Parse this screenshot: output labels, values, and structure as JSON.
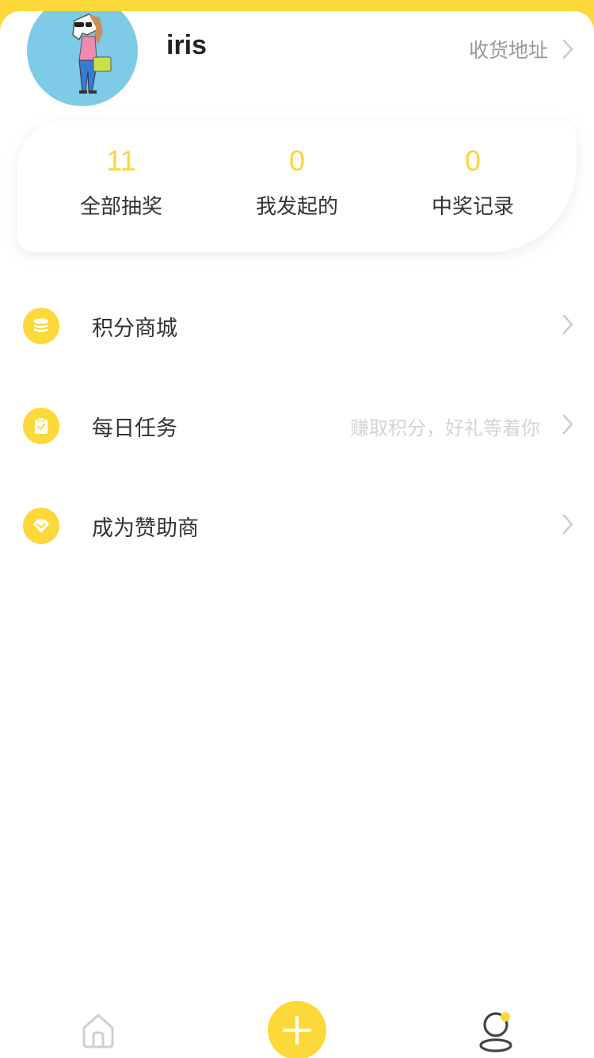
{
  "profile": {
    "username": "iris",
    "address_link": "收货地址"
  },
  "stats": [
    {
      "value": "11",
      "label": "全部抽奖"
    },
    {
      "value": "0",
      "label": "我发起的"
    },
    {
      "value": "0",
      "label": "中奖记录"
    }
  ],
  "menu": [
    {
      "label": "积分商城",
      "hint": "",
      "icon": "coins-icon"
    },
    {
      "label": "每日任务",
      "hint": "赚取积分，好礼等着你",
      "icon": "clipboard-check-icon"
    },
    {
      "label": "成为赞助商",
      "hint": "",
      "icon": "heart-diamond-icon"
    }
  ],
  "tabbar": {
    "home_icon": "home-icon",
    "add_icon": "plus-icon",
    "me_icon": "user-icon"
  },
  "colors": {
    "accent": "#fdd83a",
    "accent_text": "#fbd637",
    "avatar_bg": "#7ecbe8"
  }
}
